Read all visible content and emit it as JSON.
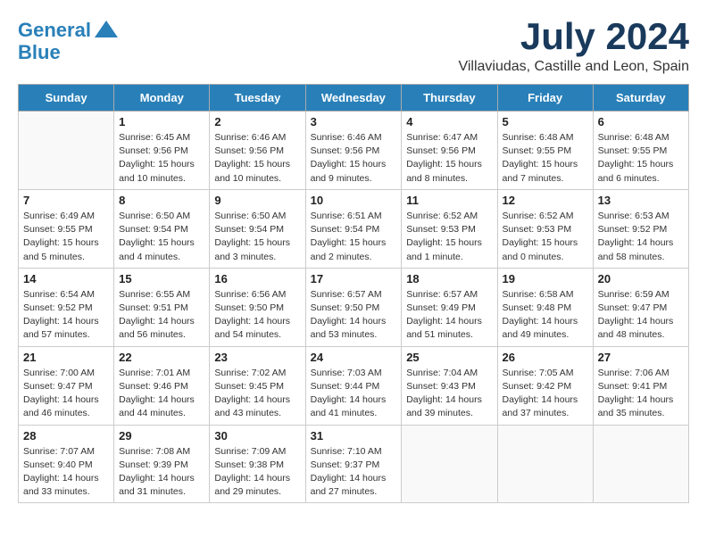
{
  "header": {
    "logo_line1": "General",
    "logo_line2": "Blue",
    "month_title": "July 2024",
    "location": "Villaviudas, Castille and Leon, Spain"
  },
  "weekdays": [
    "Sunday",
    "Monday",
    "Tuesday",
    "Wednesday",
    "Thursday",
    "Friday",
    "Saturday"
  ],
  "weeks": [
    [
      {
        "day": "",
        "info": ""
      },
      {
        "day": "1",
        "info": "Sunrise: 6:45 AM\nSunset: 9:56 PM\nDaylight: 15 hours\nand 10 minutes."
      },
      {
        "day": "2",
        "info": "Sunrise: 6:46 AM\nSunset: 9:56 PM\nDaylight: 15 hours\nand 10 minutes."
      },
      {
        "day": "3",
        "info": "Sunrise: 6:46 AM\nSunset: 9:56 PM\nDaylight: 15 hours\nand 9 minutes."
      },
      {
        "day": "4",
        "info": "Sunrise: 6:47 AM\nSunset: 9:56 PM\nDaylight: 15 hours\nand 8 minutes."
      },
      {
        "day": "5",
        "info": "Sunrise: 6:48 AM\nSunset: 9:55 PM\nDaylight: 15 hours\nand 7 minutes."
      },
      {
        "day": "6",
        "info": "Sunrise: 6:48 AM\nSunset: 9:55 PM\nDaylight: 15 hours\nand 6 minutes."
      }
    ],
    [
      {
        "day": "7",
        "info": "Sunrise: 6:49 AM\nSunset: 9:55 PM\nDaylight: 15 hours\nand 5 minutes."
      },
      {
        "day": "8",
        "info": "Sunrise: 6:50 AM\nSunset: 9:54 PM\nDaylight: 15 hours\nand 4 minutes."
      },
      {
        "day": "9",
        "info": "Sunrise: 6:50 AM\nSunset: 9:54 PM\nDaylight: 15 hours\nand 3 minutes."
      },
      {
        "day": "10",
        "info": "Sunrise: 6:51 AM\nSunset: 9:54 PM\nDaylight: 15 hours\nand 2 minutes."
      },
      {
        "day": "11",
        "info": "Sunrise: 6:52 AM\nSunset: 9:53 PM\nDaylight: 15 hours\nand 1 minute."
      },
      {
        "day": "12",
        "info": "Sunrise: 6:52 AM\nSunset: 9:53 PM\nDaylight: 15 hours\nand 0 minutes."
      },
      {
        "day": "13",
        "info": "Sunrise: 6:53 AM\nSunset: 9:52 PM\nDaylight: 14 hours\nand 58 minutes."
      }
    ],
    [
      {
        "day": "14",
        "info": "Sunrise: 6:54 AM\nSunset: 9:52 PM\nDaylight: 14 hours\nand 57 minutes."
      },
      {
        "day": "15",
        "info": "Sunrise: 6:55 AM\nSunset: 9:51 PM\nDaylight: 14 hours\nand 56 minutes."
      },
      {
        "day": "16",
        "info": "Sunrise: 6:56 AM\nSunset: 9:50 PM\nDaylight: 14 hours\nand 54 minutes."
      },
      {
        "day": "17",
        "info": "Sunrise: 6:57 AM\nSunset: 9:50 PM\nDaylight: 14 hours\nand 53 minutes."
      },
      {
        "day": "18",
        "info": "Sunrise: 6:57 AM\nSunset: 9:49 PM\nDaylight: 14 hours\nand 51 minutes."
      },
      {
        "day": "19",
        "info": "Sunrise: 6:58 AM\nSunset: 9:48 PM\nDaylight: 14 hours\nand 49 minutes."
      },
      {
        "day": "20",
        "info": "Sunrise: 6:59 AM\nSunset: 9:47 PM\nDaylight: 14 hours\nand 48 minutes."
      }
    ],
    [
      {
        "day": "21",
        "info": "Sunrise: 7:00 AM\nSunset: 9:47 PM\nDaylight: 14 hours\nand 46 minutes."
      },
      {
        "day": "22",
        "info": "Sunrise: 7:01 AM\nSunset: 9:46 PM\nDaylight: 14 hours\nand 44 minutes."
      },
      {
        "day": "23",
        "info": "Sunrise: 7:02 AM\nSunset: 9:45 PM\nDaylight: 14 hours\nand 43 minutes."
      },
      {
        "day": "24",
        "info": "Sunrise: 7:03 AM\nSunset: 9:44 PM\nDaylight: 14 hours\nand 41 minutes."
      },
      {
        "day": "25",
        "info": "Sunrise: 7:04 AM\nSunset: 9:43 PM\nDaylight: 14 hours\nand 39 minutes."
      },
      {
        "day": "26",
        "info": "Sunrise: 7:05 AM\nSunset: 9:42 PM\nDaylight: 14 hours\nand 37 minutes."
      },
      {
        "day": "27",
        "info": "Sunrise: 7:06 AM\nSunset: 9:41 PM\nDaylight: 14 hours\nand 35 minutes."
      }
    ],
    [
      {
        "day": "28",
        "info": "Sunrise: 7:07 AM\nSunset: 9:40 PM\nDaylight: 14 hours\nand 33 minutes."
      },
      {
        "day": "29",
        "info": "Sunrise: 7:08 AM\nSunset: 9:39 PM\nDaylight: 14 hours\nand 31 minutes."
      },
      {
        "day": "30",
        "info": "Sunrise: 7:09 AM\nSunset: 9:38 PM\nDaylight: 14 hours\nand 29 minutes."
      },
      {
        "day": "31",
        "info": "Sunrise: 7:10 AM\nSunset: 9:37 PM\nDaylight: 14 hours\nand 27 minutes."
      },
      {
        "day": "",
        "info": ""
      },
      {
        "day": "",
        "info": ""
      },
      {
        "day": "",
        "info": ""
      }
    ]
  ]
}
